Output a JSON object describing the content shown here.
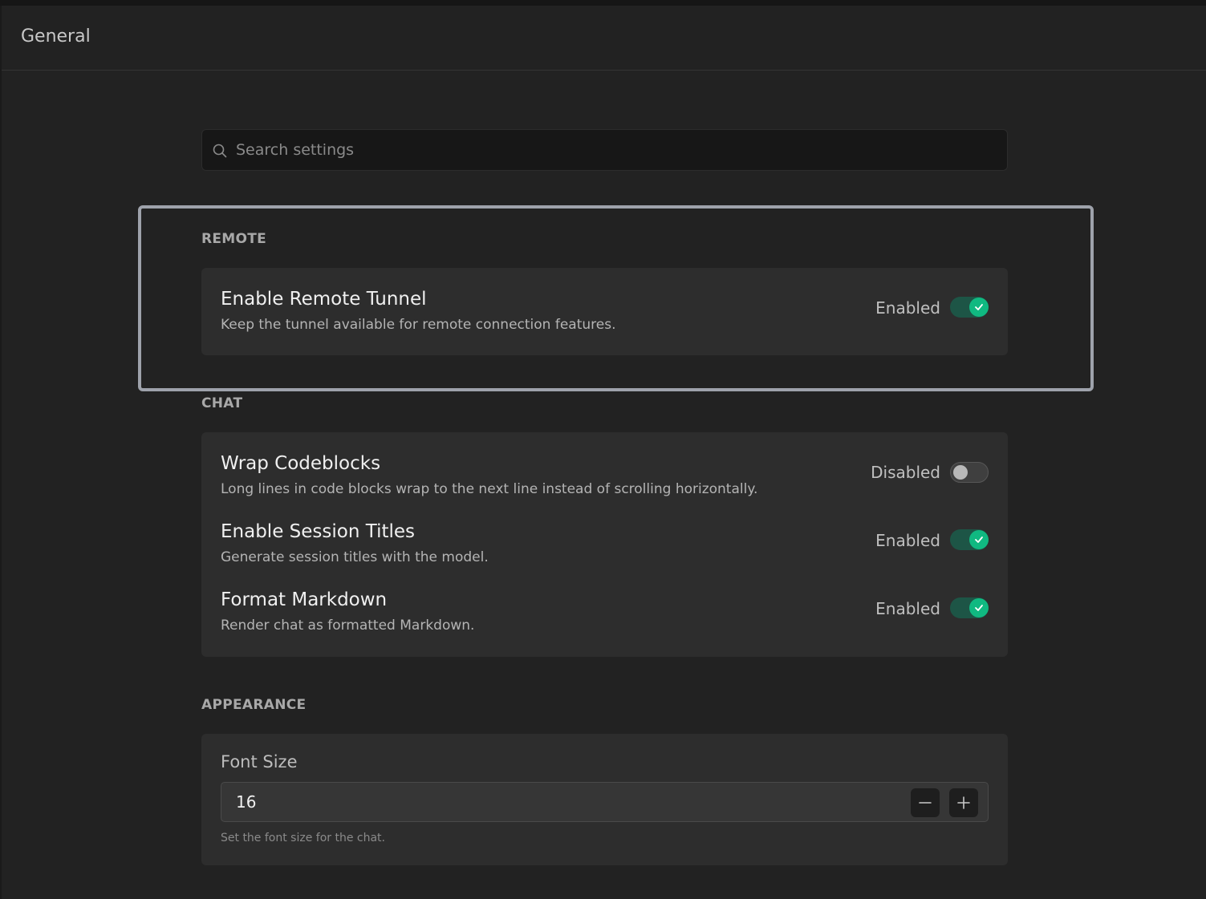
{
  "header": {
    "title": "General"
  },
  "search": {
    "placeholder": "Search settings",
    "value": ""
  },
  "sections": {
    "remote": {
      "label": "REMOTE",
      "items": [
        {
          "title": "Enable Remote Tunnel",
          "description": "Keep the tunnel available for remote connection features.",
          "status": "Enabled",
          "enabled": true
        }
      ]
    },
    "chat": {
      "label": "CHAT",
      "items": [
        {
          "title": "Wrap Codeblocks",
          "description": "Long lines in code blocks wrap to the next line instead of scrolling horizontally.",
          "status": "Disabled",
          "enabled": false
        },
        {
          "title": "Enable Session Titles",
          "description": "Generate session titles with the model.",
          "status": "Enabled",
          "enabled": true
        },
        {
          "title": "Format Markdown",
          "description": "Render chat as formatted Markdown.",
          "status": "Enabled",
          "enabled": true
        }
      ]
    },
    "appearance": {
      "label": "APPEARANCE",
      "font_size": {
        "label": "Font Size",
        "value": "16",
        "help": "Set the font size for the chat."
      }
    }
  },
  "icons": {
    "search": "search-icon",
    "check": "check-icon",
    "decrement": "minus-icon",
    "increment": "plus-icon"
  },
  "colors": {
    "background": "#222222",
    "card": "#2d2d2d",
    "accent": "#10b981",
    "toggle_on_track": "#1d5546",
    "highlight_border": "#9ea2ab"
  }
}
